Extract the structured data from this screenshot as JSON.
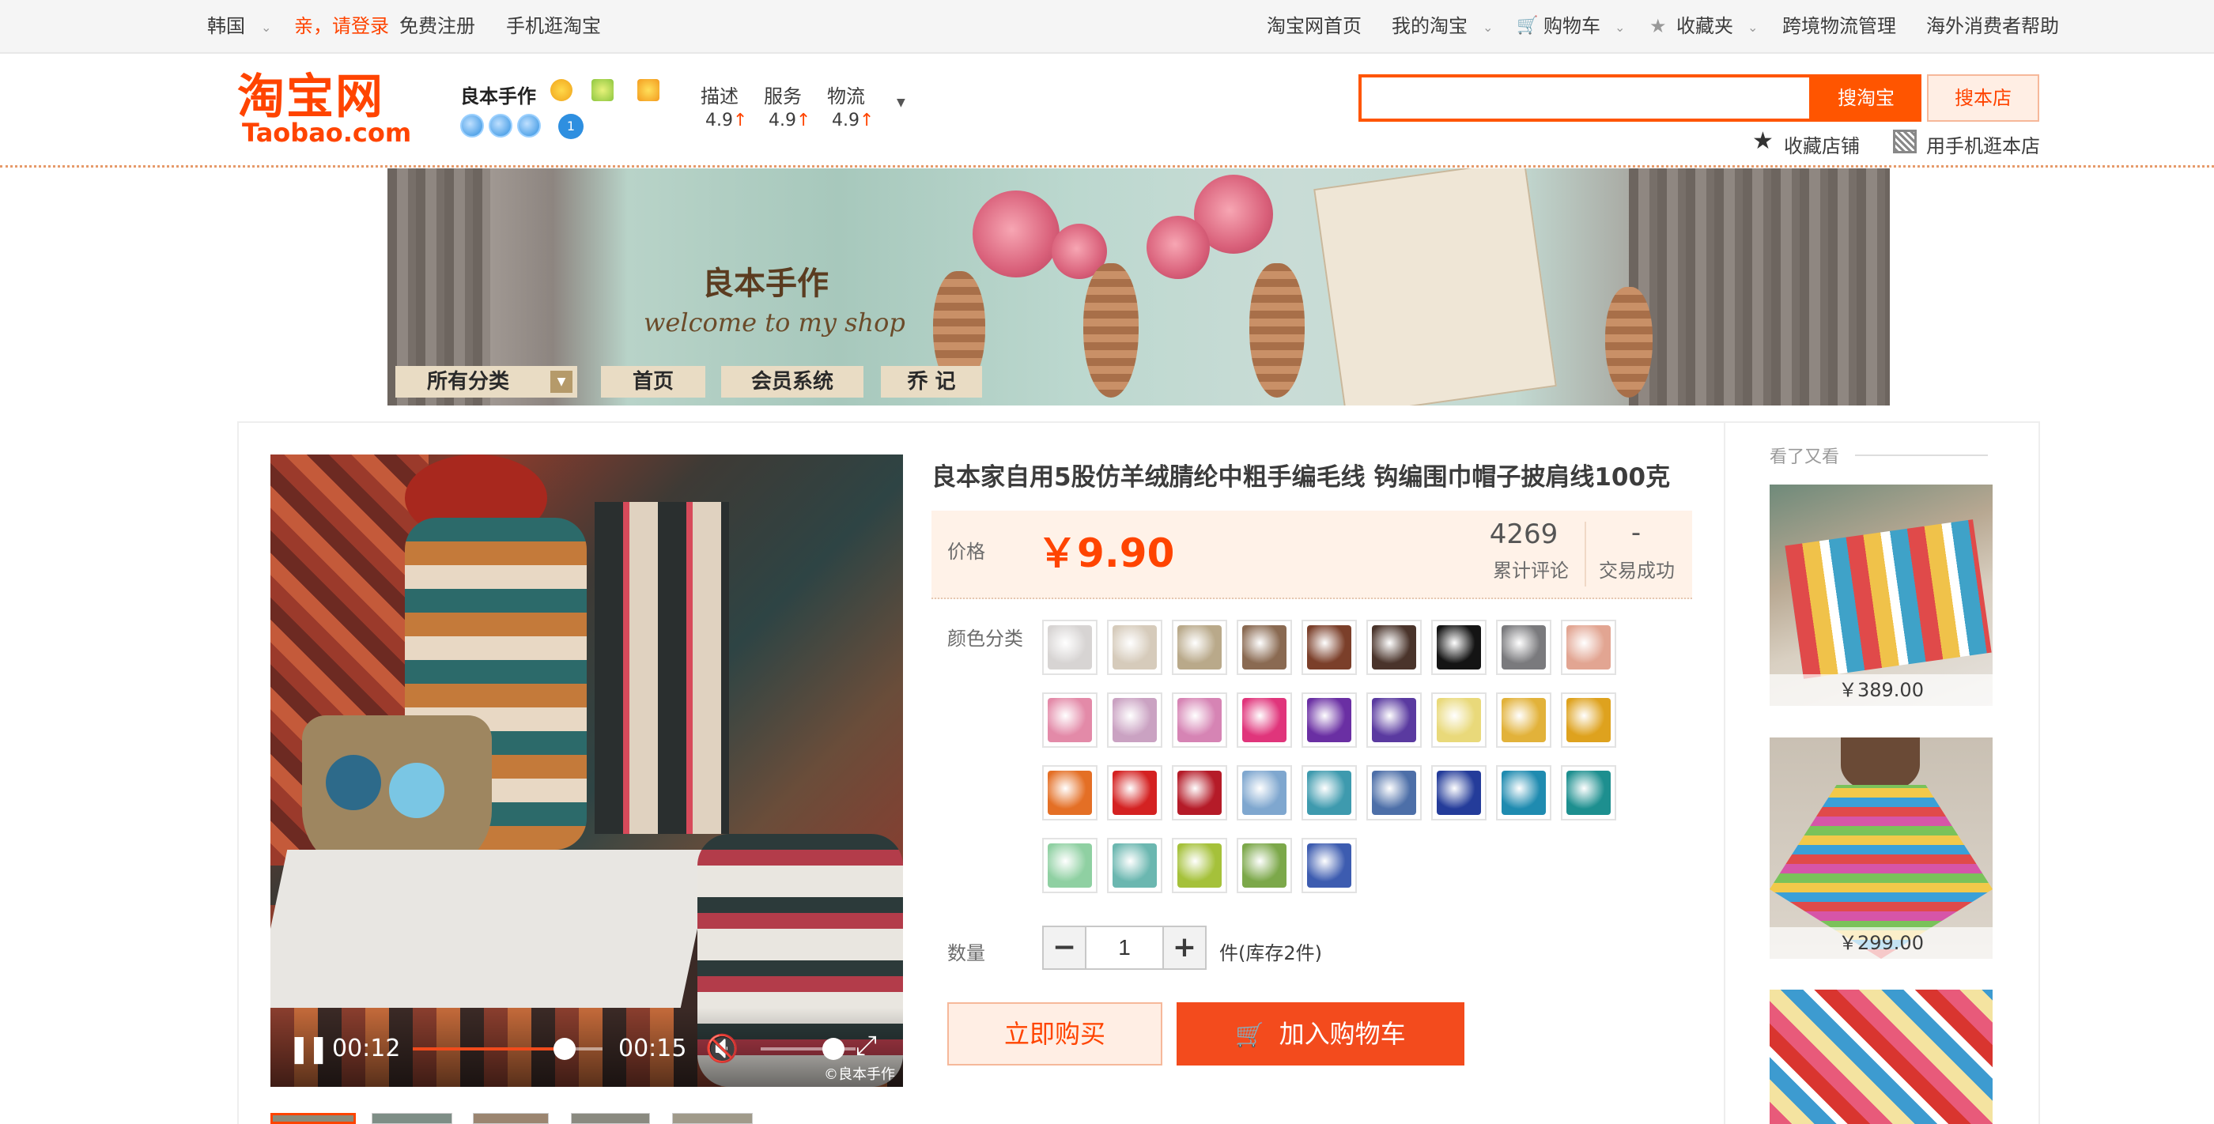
{
  "topbar": {
    "region": "韩国",
    "login": "亲，请登录",
    "register": "免费注册",
    "mobile": "手机逛淘宝",
    "home": "淘宝网首页",
    "my_taobao": "我的淘宝",
    "cart": "购物车",
    "favorites": "收藏夹",
    "logistics": "跨境物流管理",
    "help": "海外消费者帮助"
  },
  "logo": {
    "cn": "淘宝网",
    "en": "Taobao.com"
  },
  "shop": {
    "name": "良本手作",
    "ratings": [
      {
        "label": "描述",
        "value": "4.9"
      },
      {
        "label": "服务",
        "value": "4.9"
      },
      {
        "label": "物流",
        "value": "4.9"
      }
    ]
  },
  "search": {
    "placeholder": "",
    "search_taobao": "搜淘宝",
    "search_shop": "搜本店",
    "collect_shop": "收藏店铺",
    "mobile_shop": "用手机逛本店"
  },
  "banner": {
    "title": "良本手作",
    "subtitle": "welcome to my shop",
    "nav": [
      "所有分类",
      "首页",
      "会员系统",
      "乔 记"
    ]
  },
  "video": {
    "current": "00:12",
    "duration": "00:15",
    "progress": 0.8,
    "watermark": "©良本手作"
  },
  "product": {
    "title": "良本家自用5股仿羊绒腈纶中粗手编毛线 钩编围巾帽子披肩线100克",
    "price_label": "价格",
    "price": "￥9.90",
    "reviews_count": "4269",
    "reviews_label": "累计评论",
    "deals_count": "-",
    "deals_label": "交易成功",
    "color_label": "颜色分类",
    "swatch_colors": [
      "#d7d4d3",
      "#d6cbbb",
      "#b9a98a",
      "#8a6a52",
      "#7b3f2a",
      "#4a342b",
      "#141414",
      "#7a7a7d",
      "#e2a592",
      "#e38aa8",
      "#caa2c2",
      "#d684b4",
      "#e0357b",
      "#6a2fa3",
      "#5a3aa0",
      "#e9d97a",
      "#e2b23a",
      "#dea21e",
      "#e46f25",
      "#d42222",
      "#b51b28",
      "#7fa7cf",
      "#3e9aae",
      "#4d6fa8",
      "#243c9a",
      "#1f8bb0",
      "#1d8f8f",
      "#8fd0a2",
      "#6bb7b0",
      "#a5c13a",
      "#7ca84a",
      "#3d5cb0"
    ],
    "qty_label": "数量",
    "qty_value": "1",
    "stock": "件(库存2件)",
    "buy_now": "立即购买",
    "add_cart": "加入购物车"
  },
  "side": {
    "title": "看了又看",
    "items": [
      {
        "price": "￥389.00"
      },
      {
        "price": "￥299.00"
      },
      {
        "price": ""
      }
    ]
  }
}
